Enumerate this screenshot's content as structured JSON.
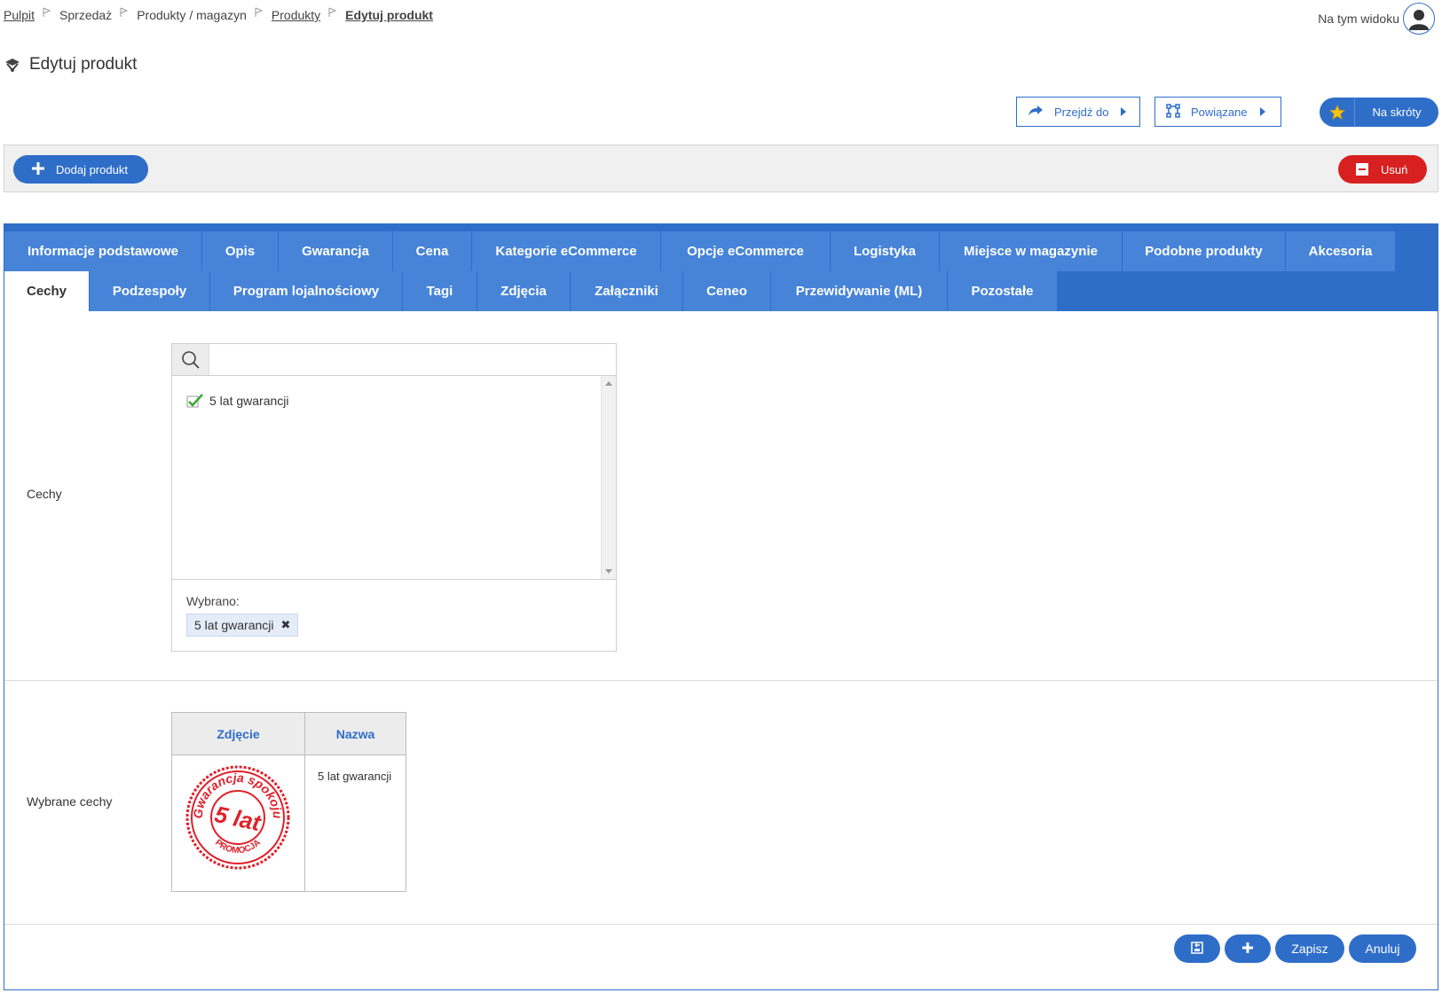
{
  "breadcrumb": [
    {
      "label": "Pulpit",
      "type": "link"
    },
    {
      "label": "Sprzedaż",
      "type": "plain"
    },
    {
      "label": "Produkty / magazyn",
      "type": "plain"
    },
    {
      "label": "Produkty",
      "type": "link"
    },
    {
      "label": "Edytuj produkt",
      "type": "current"
    }
  ],
  "user": {
    "view_label": "Na tym widoku",
    "avatar_icon": "user-avatar-icon"
  },
  "page": {
    "title": "Edytuj produkt",
    "icon": "product-icon"
  },
  "actions": {
    "goto_label": "Przejdź do",
    "related_label": "Powiązane",
    "shortcuts_label": "Na skróty"
  },
  "toolbar": {
    "add_label": "Dodaj produkt",
    "delete_label": "Usuń"
  },
  "tabs": {
    "row1": [
      "Informacje podstawowe",
      "Opis",
      "Gwarancja",
      "Cena",
      "Kategorie eCommerce",
      "Opcje eCommerce",
      "Logistyka",
      "Miejsce w magazynie",
      "Podobne produkty",
      "Akcesoria"
    ],
    "row2": [
      "Cechy",
      "Podzespoły",
      "Program lojalnościowy",
      "Tagi",
      "Zdjęcia",
      "Załączniki",
      "Ceneo",
      "Przewidywanie (ML)",
      "Pozostałe"
    ],
    "active": "Cechy"
  },
  "features": {
    "label": "Cechy",
    "search_value": "",
    "items": [
      {
        "label": "5 lat gwarancji",
        "checked": true
      }
    ],
    "selected_label": "Wybrano:",
    "selected_chips": [
      "5 lat gwarancji"
    ]
  },
  "selected_features": {
    "label": "Wybrane cechy",
    "columns": [
      "Zdjęcie",
      "Nazwa"
    ],
    "rows": [
      {
        "name": "5 lat gwarancji",
        "image": {
          "ring_text": "Gwarancja spokoju",
          "center_text": "5 lat",
          "bottom_text": "PROMOCJA"
        }
      }
    ]
  },
  "footer": {
    "save_label": "Zapisz",
    "cancel_label": "Anuluj"
  },
  "colors": {
    "primary": "#2f6ec8",
    "tab": "#4784d8",
    "danger": "#d7201f",
    "stamp": "#e0202a"
  }
}
